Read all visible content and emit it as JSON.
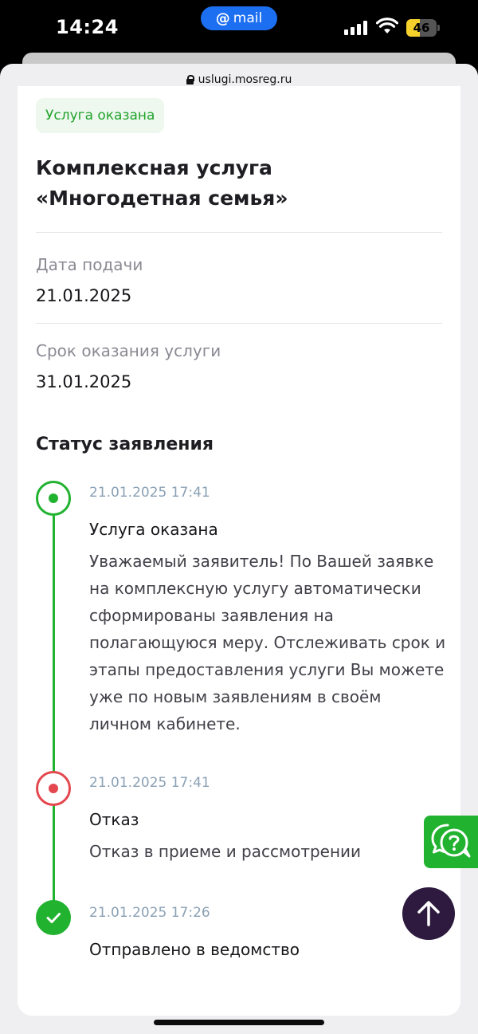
{
  "status_bar": {
    "time": "14:24",
    "mail_app": "mail",
    "mail_symbol": "@",
    "battery": "46",
    "battery_level_percent": 46,
    "icons": [
      "signal-icon",
      "wifi-icon",
      "battery-icon"
    ]
  },
  "browser": {
    "url": "uslugi.mosreg.ru",
    "url_icon": "lock-icon"
  },
  "service": {
    "status_badge": "Услуга оказана",
    "title": "Комплексная услуга «Многодетная семья»"
  },
  "details": {
    "submit_date_label": "Дата подачи",
    "submit_date": "21.01.2025",
    "deadline_label": "Срок оказания услуги",
    "deadline": "31.01.2025"
  },
  "status_section": {
    "title": "Статус заявления",
    "events": [
      {
        "datetime": "21.01.2025 17:41",
        "title": "Услуга оказана",
        "text": "Уважаемый заявитель! По Вашей заявке на комплексную услугу автоматически сформированы заявления на полагающуюся меру. Отслеживать срок и этапы предоставления услуги Вы можете уже по новым заявлениям в своём личном кабинете.",
        "state": "current",
        "color": "#21b22f"
      },
      {
        "datetime": "21.01.2025 17:41",
        "title": "Отказ",
        "text": "Отказ в приеме и рассмотрении",
        "state": "rejected",
        "color": "#e4474e"
      },
      {
        "datetime": "21.01.2025 17:26",
        "title": "Отправлено в ведомство",
        "state": "done",
        "color": "#21b22f"
      }
    ]
  },
  "floating": {
    "help_icon": "chat-question-icon",
    "scroll_top_icon": "arrow-up-icon"
  },
  "colors": {
    "accent_green": "#21b22f",
    "error_red": "#e4474e",
    "scroll_button": "#2d1a3e",
    "mail_blue": "#1d6ff2"
  }
}
